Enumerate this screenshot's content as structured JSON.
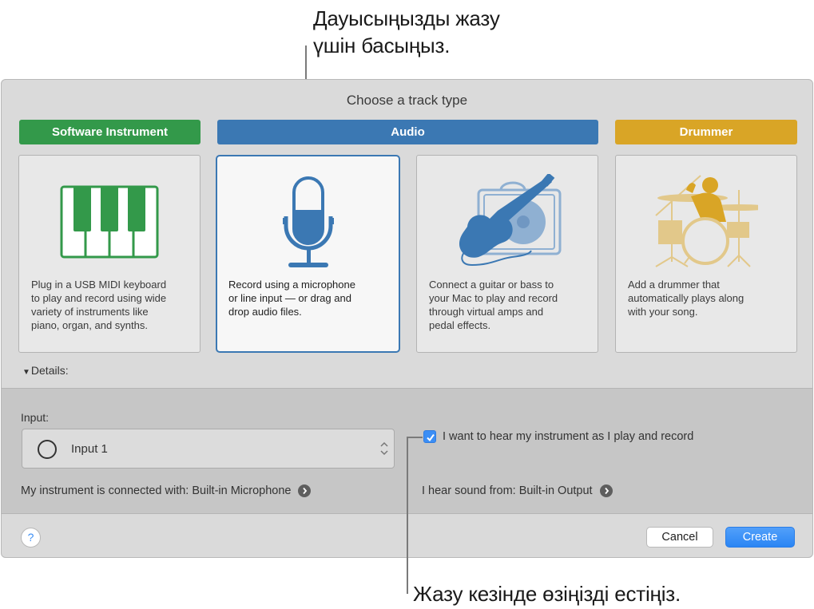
{
  "callouts": {
    "top": [
      "Дауысыңызды жазу",
      "үшін басыңыз."
    ],
    "bottom": "Жазу кезінде өзіңізді естіңіз."
  },
  "dialog": {
    "title": "Choose a track type",
    "track_types": [
      {
        "label": "Software Instrument",
        "color": "#33994a",
        "icon": "piano-keyboard-icon",
        "description": [
          "Plug in a USB MIDI keyboard",
          "to play and record using wide",
          "variety of instruments like",
          "piano, organ, and synths."
        ],
        "selected": false
      },
      {
        "label": "Audio",
        "color": "#3b78b3",
        "icon": "microphone-icon",
        "description": [
          "Record using a microphone",
          "or line input — or drag and",
          "drop audio files."
        ],
        "selected": true
      },
      {
        "label": "",
        "color": "#3b78b3",
        "icon": "guitar-amp-icon",
        "description": [
          "Connect a guitar or bass to",
          "your Mac to play and record",
          "through virtual amps and",
          "pedal effects."
        ],
        "selected": false
      },
      {
        "label": "Drummer",
        "color": "#d9a526",
        "icon": "drummer-icon",
        "description": [
          "Add a drummer that",
          "automatically plays along",
          "with your song."
        ],
        "selected": false
      }
    ],
    "details": {
      "toggle_label": "Details:",
      "expanded": true,
      "input_label": "Input:",
      "input_value": "Input 1",
      "monitor_label": "I want to hear my instrument as I play and record",
      "monitor_checked": true,
      "connected_with": "My instrument is connected with: Built-in Microphone",
      "hear_from": "I hear sound from: Built-in Output"
    },
    "footer": {
      "help_label": "?",
      "cancel_label": "Cancel",
      "create_label": "Create"
    }
  }
}
